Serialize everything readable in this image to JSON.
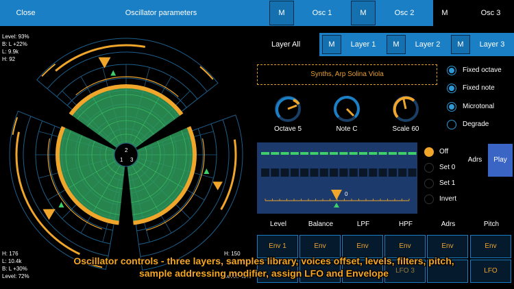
{
  "topbar": {
    "close": "Close",
    "title": "Oscillator parameters",
    "mute": "M",
    "tabs": [
      "Osc 1",
      "Osc 2",
      "Osc 3"
    ]
  },
  "radar": {
    "top_left": {
      "level": "Level: 93%",
      "balance": "B: L +22%",
      "lpf": "L: 9.9k",
      "hpf": "H: 92"
    },
    "bottom_left": {
      "hpf": "H: 176",
      "lpf": "L: 10.4k",
      "balance": "B: L +30%",
      "level": "Level: 72%"
    },
    "bottom_right": {
      "hpf": "H: 150",
      "level": "Level: 43%"
    },
    "center_labels": [
      "1",
      "2",
      "3"
    ]
  },
  "layers": {
    "label": "Layer All",
    "mute": "M",
    "items": [
      "Layer 1",
      "Layer 2",
      "Layer 3"
    ]
  },
  "library": "Synths, Arp Solina Viola",
  "options": [
    {
      "label": "Fixed octave",
      "on": true
    },
    {
      "label": "Fixed note",
      "on": true
    },
    {
      "label": "Microtonal",
      "on": true
    },
    {
      "label": "Degrade",
      "on": false
    }
  ],
  "knobs": [
    {
      "label": "Octave 5"
    },
    {
      "label": "Note C"
    },
    {
      "label": "Scale 60"
    }
  ],
  "sequencer": {
    "marker_value": "0",
    "modes": [
      {
        "label": "Off",
        "on": true
      },
      {
        "label": "Set 0",
        "on": false
      },
      {
        "label": "Set 1",
        "on": false
      },
      {
        "label": "Invert",
        "on": false
      }
    ],
    "adrs": "Adrs",
    "play": "Play"
  },
  "modulation": {
    "columns": [
      "Level",
      "Balance",
      "LPF",
      "HPF",
      "Adrs",
      "Pitch"
    ],
    "row1": [
      "Env 1",
      "Env",
      "Env",
      "Env",
      "Env",
      "Env"
    ],
    "row2": [
      "LFO 3",
      "LFO"
    ]
  },
  "caption": {
    "line1": "Oscillator controls - three layers, samples library, voices offset, levels, filters, pitch,",
    "line2": "sample addressing modifier, assign LFO and Envelope"
  },
  "colors": {
    "accent_blue": "#1a7fc4",
    "orange": "#f0a52b",
    "green": "#3fcf6a",
    "sequencer_bg": "#1c3a6b",
    "play": "#3b65c4"
  }
}
